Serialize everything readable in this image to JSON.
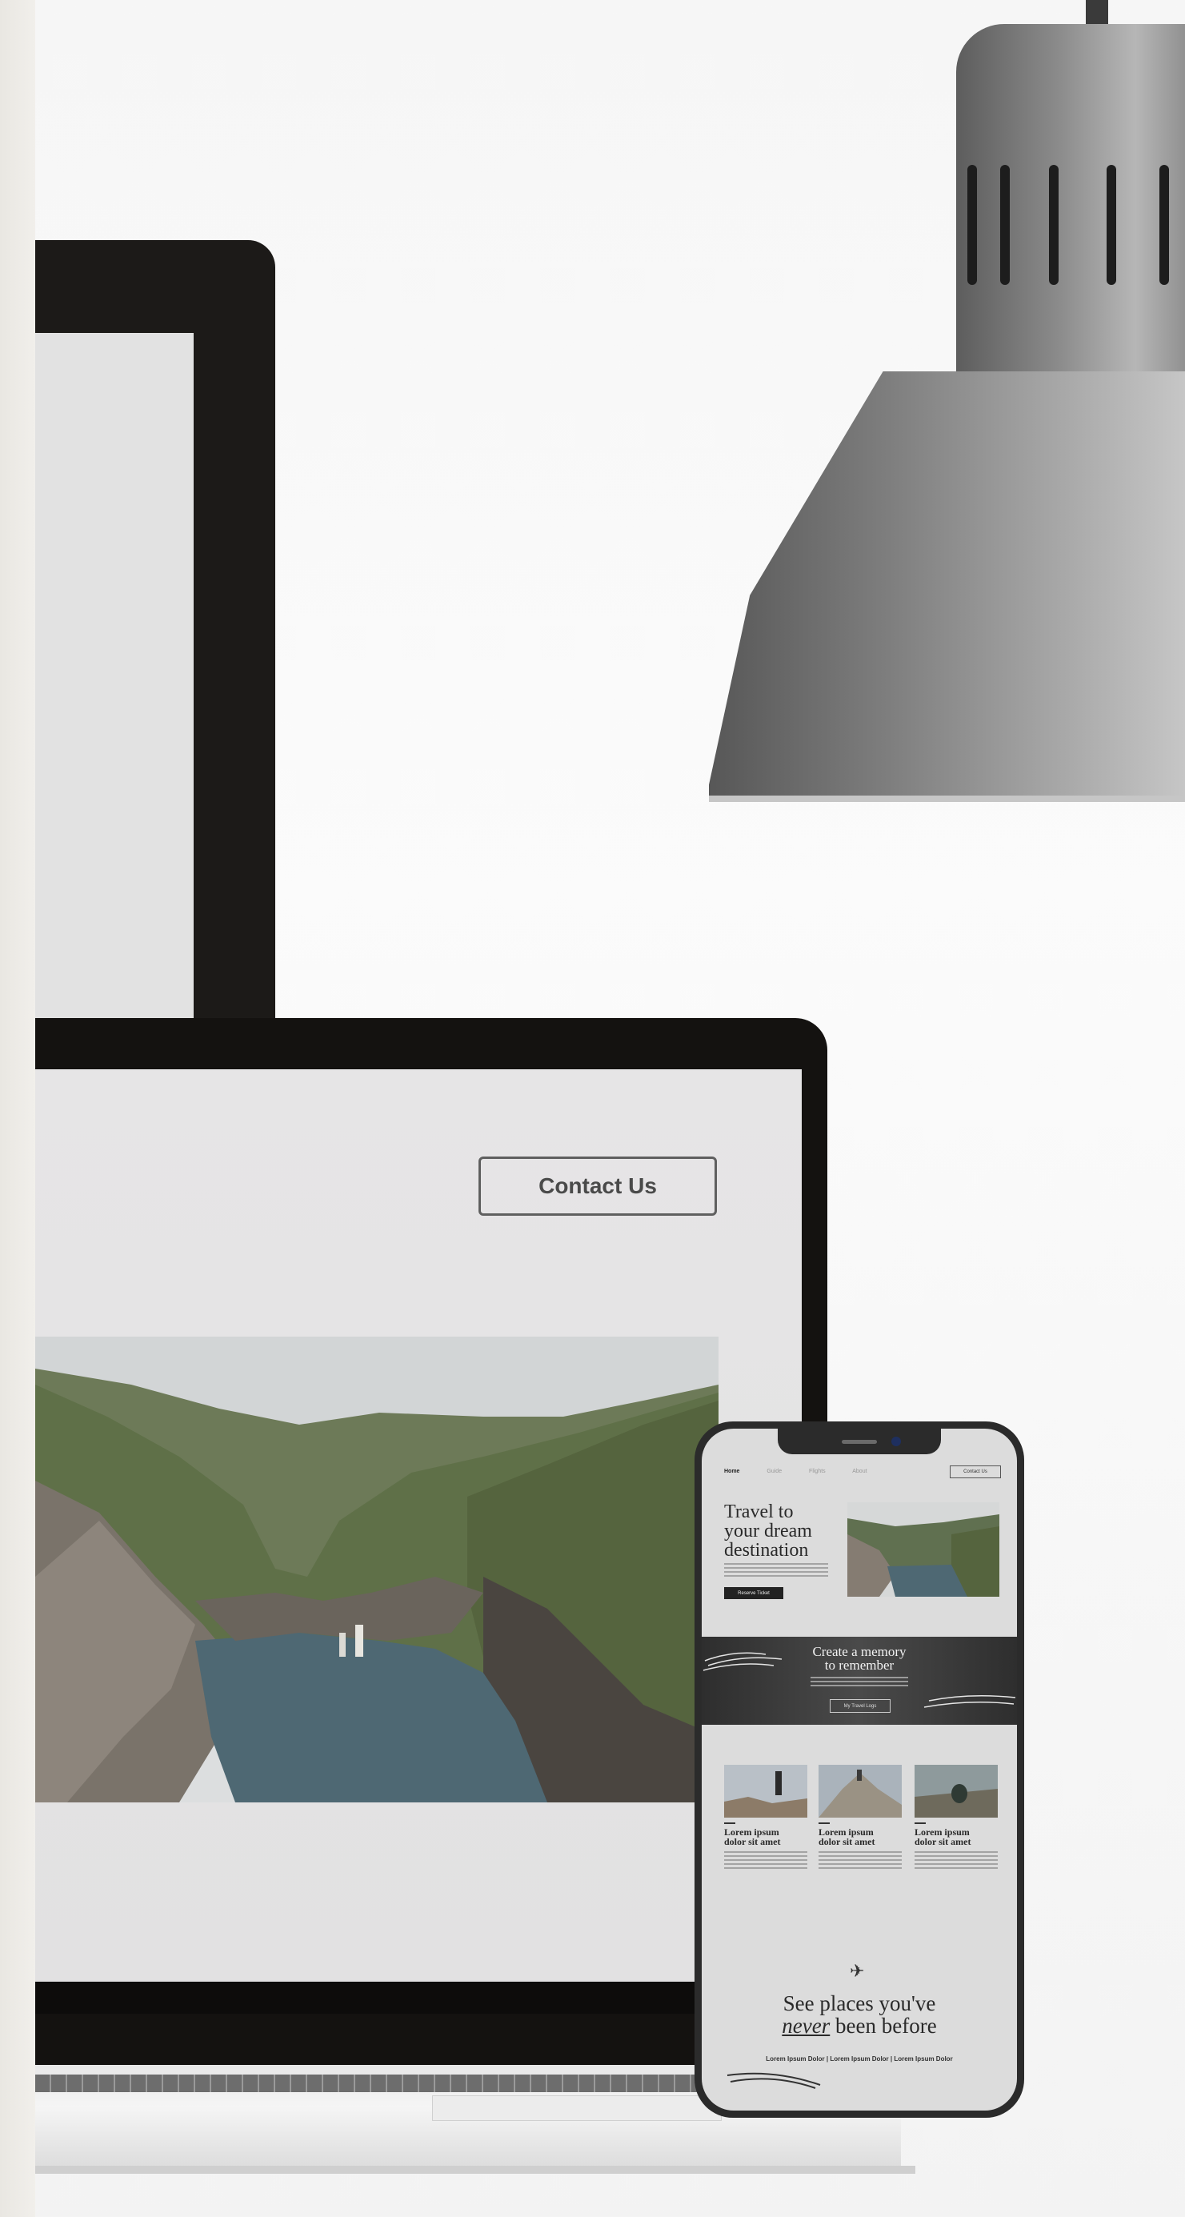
{
  "laptop_page": {
    "contact_button": "Contact Us"
  },
  "phone_page": {
    "nav": [
      "Home",
      "Guide",
      "Flights",
      "About"
    ],
    "contact_button": "Contact Us",
    "hero": {
      "title_line1": "Travel to",
      "title_line2": "your dream",
      "title_line3": "destination",
      "button": "Reserve Ticket"
    },
    "band": {
      "title_line1": "Create a memory",
      "title_line2": "to remember",
      "button": "My Travel Logs"
    },
    "cards": [
      {
        "title_line1": "Lorem ipsum",
        "title_line2": "dolor sit amet"
      },
      {
        "title_line1": "Lorem ipsum",
        "title_line2": "dolor sit amet"
      },
      {
        "title_line1": "Lorem ipsum",
        "title_line2": "dolor sit amet"
      }
    ],
    "cta": {
      "line1": "See places you've",
      "line2_em": "never",
      "line2_rest": " been before",
      "subtitle": "Lorem Ipsum Dolor | Lorem Ipsum Dolor | Lorem Ipsum Dolor"
    }
  },
  "icons": {
    "plane": "plane-icon"
  }
}
